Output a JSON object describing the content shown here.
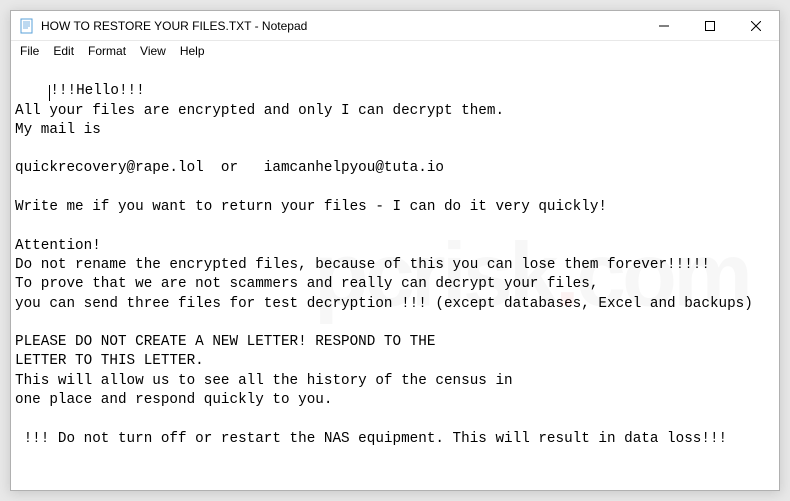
{
  "window": {
    "title": "HOW TO RESTORE YOUR FILES.TXT - Notepad"
  },
  "menubar": {
    "file": "File",
    "edit": "Edit",
    "format": "Format",
    "view": "View",
    "help": "Help"
  },
  "document": {
    "lines": [
      "!!!Hello!!!",
      "All your files are encrypted and only I can decrypt them.",
      "My mail is",
      "",
      "quickrecovery@rape.lol  or   iamcanhelpyou@tuta.io",
      "",
      "Write me if you want to return your files - I can do it very quickly!",
      "",
      "Attention!",
      "Do not rename the encrypted files, because of this you can lose them forever!!!!!",
      "To prove that we are not scammers and really can decrypt your files,",
      "you can send three files for test decryption !!! (except databases, Excel and backups)",
      "",
      "PLEASE DO NOT CREATE A NEW LETTER! RESPOND TO THE",
      "LETTER TO THIS LETTER.",
      "This will allow us to see all the history of the census in",
      "one place and respond quickly to you.",
      "",
      " !!! Do not turn off or restart the NAS equipment. This will result in data loss!!!"
    ]
  }
}
